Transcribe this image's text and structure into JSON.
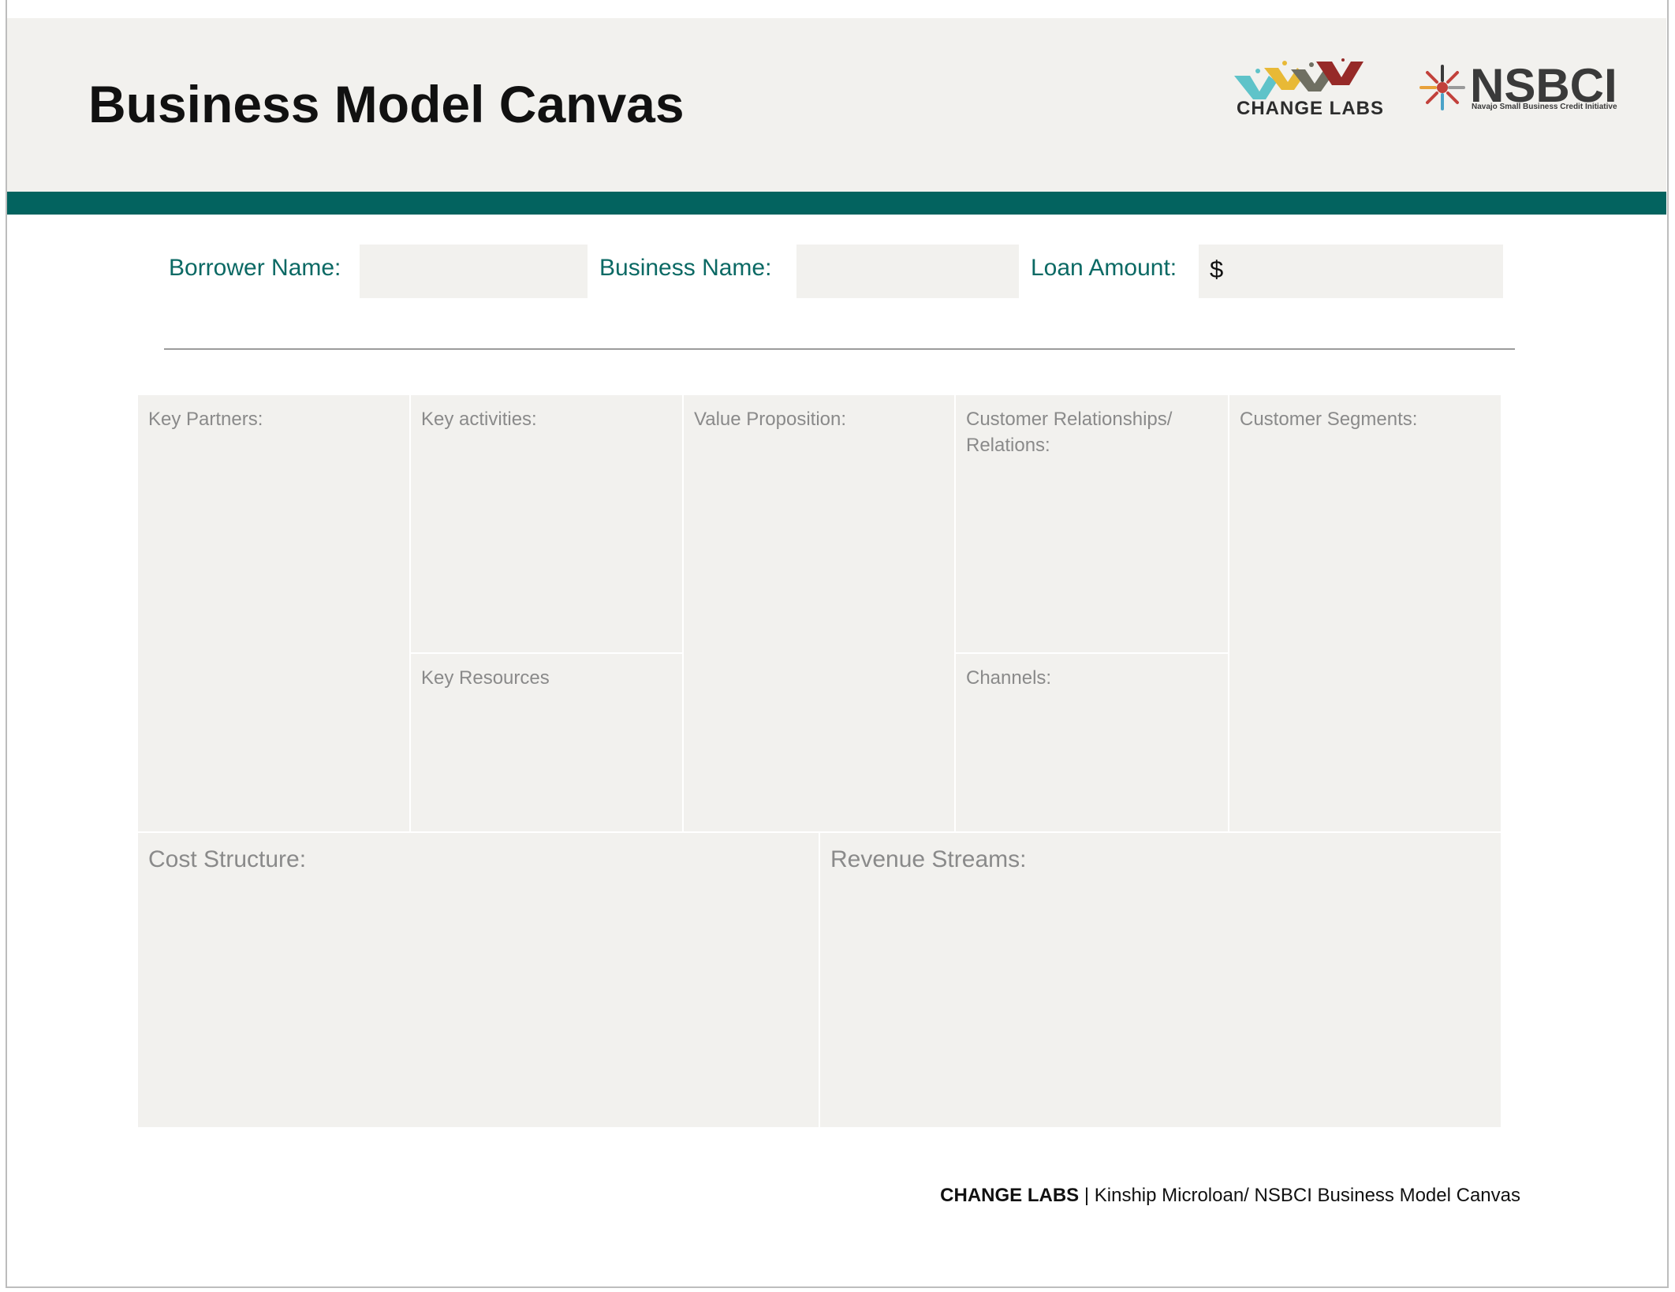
{
  "header": {
    "title": "Business Model Canvas",
    "logos": {
      "change_labs": "CHANGE LABS",
      "nsbci": "NSBCI",
      "nsbci_tagline": "Navajo Small Business Credit Initiative"
    }
  },
  "colors": {
    "teal": "#03635f",
    "panel": "#f2f1ee",
    "label_gray": "#8a8a8a"
  },
  "form": {
    "borrower_label": "Borrower Name:",
    "borrower_value": "",
    "business_label": "Business Name:",
    "business_value": "",
    "loan_label": "Loan Amount:",
    "loan_prefix": "$",
    "loan_value": ""
  },
  "canvas": {
    "key_partners": "Key Partners:",
    "key_activities": "Key activities:",
    "key_resources": "Key Resources",
    "value_proposition": "Value Proposition:",
    "customer_relationships_line1": "Customer Relationships/",
    "customer_relationships_line2": "Relations:",
    "channels": "Channels:",
    "customer_segments": "Customer Segments:",
    "cost_structure": "Cost Structure:",
    "revenue_streams": "Revenue Streams:"
  },
  "footer": {
    "brand": "CHANGE LABS",
    "text": " | Kinship Microloan/ NSBCI Business Model Canvas"
  }
}
